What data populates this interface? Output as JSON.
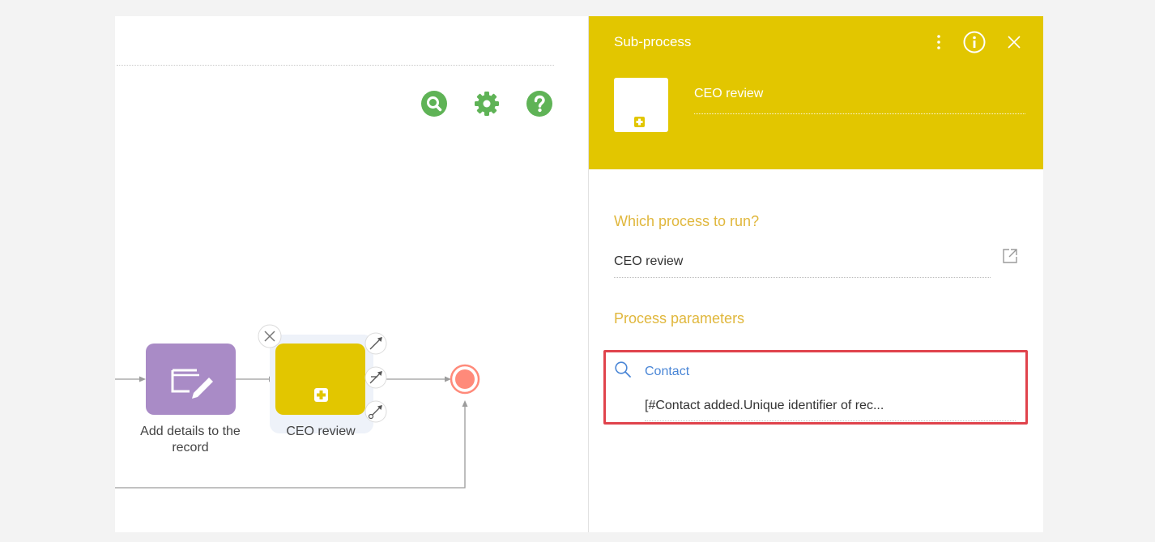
{
  "toolbar": {
    "icons": [
      "search-icon",
      "gear-icon",
      "help-icon"
    ],
    "accent_color": "#5fb356"
  },
  "diagram": {
    "nodes": [
      {
        "label": "Add details to the record",
        "label_lines": [
          "Add details to the",
          "record"
        ],
        "type": "task",
        "color": "#a98bc6",
        "icon": "edit-page-icon"
      },
      {
        "label": "CEO review",
        "type": "sub-process",
        "color": "#e2c600",
        "icon": "plus-box-icon",
        "selected": true
      },
      {
        "label": "",
        "type": "end-event",
        "color": "#ff8a7a"
      }
    ],
    "node_actions": [
      "close-icon",
      "connect-icon",
      "connect-conditional-icon",
      "connect-default-icon"
    ]
  },
  "panel": {
    "title": "Sub-process",
    "header_color": "#e2c600",
    "header_icons": [
      "more-vertical-icon",
      "info-icon",
      "close-icon"
    ],
    "element_name": "CEO review",
    "which_process_label": "Which process to run?",
    "which_process_value": "CEO review",
    "process_parameters_label": "Process parameters",
    "label_color": "#e0b73c",
    "parameter": {
      "name": "Contact",
      "value": "[#Contact added.Unique identifier of rec..."
    },
    "highlight_color": "#e0434c"
  }
}
